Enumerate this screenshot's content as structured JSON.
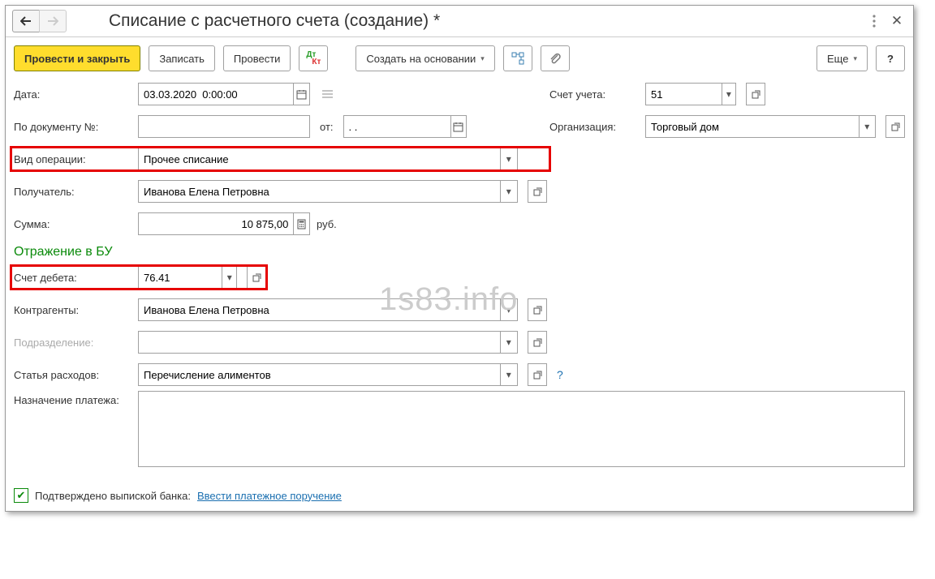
{
  "title": "Списание с расчетного счета (создание) *",
  "toolbar": {
    "post_close": "Провести и закрыть",
    "save": "Записать",
    "post": "Провести",
    "create_based": "Создать на основании",
    "more": "Еще"
  },
  "fields": {
    "date_label": "Дата:",
    "date_value": "03.03.2020  0:00:00",
    "docno_label": "По документу №:",
    "docno_value": "",
    "docno_from_label": "от:",
    "docno_from_value": ". .",
    "account_label": "Счет учета:",
    "account_value": "51",
    "org_label": "Организация:",
    "org_value": "Торговый дом",
    "optype_label": "Вид операции:",
    "optype_value": "Прочее списание",
    "payee_label": "Получатель:",
    "payee_value": "Иванова Елена Петровна",
    "sum_label": "Сумма:",
    "sum_value": "10 875,00",
    "sum_currency": "руб.",
    "bu_header": "Отражение в БУ",
    "debit_label": "Счет дебета:",
    "debit_value": "76.41",
    "cpty_label": "Контрагенты:",
    "cpty_value": "Иванова Елена Петровна",
    "dept_label": "Подразделение:",
    "dept_value": "",
    "expense_label": "Статья расходов:",
    "expense_value": "Перечисление алиментов",
    "purpose_label": "Назначение платежа:",
    "purpose_value": ""
  },
  "footer": {
    "confirmed_label": "Подтверждено выпиской банка:",
    "link": "Ввести платежное поручение"
  },
  "watermark": "1s83.info"
}
